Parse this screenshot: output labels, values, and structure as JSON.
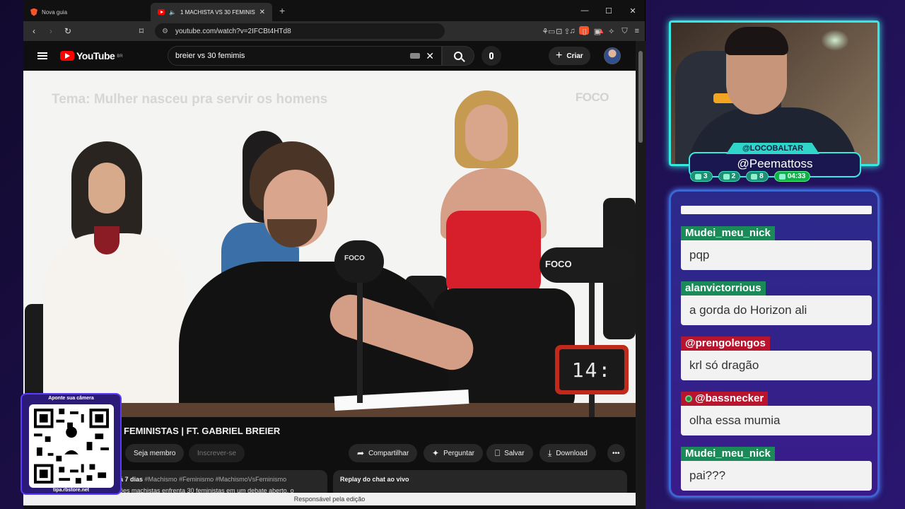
{
  "browser": {
    "tabs": [
      {
        "title": "Nova guia",
        "active": false
      },
      {
        "title": "1 MACHISTA VS 30 FEMINISTAS | FT.",
        "active": true
      }
    ],
    "url": "youtube.com/watch?v=2IFCBt4HTd8",
    "shield_count": "99+",
    "alert_count": "1"
  },
  "youtube": {
    "logo_text": "YouTube",
    "country": "BR",
    "search_value": "breier vs 30 femimis",
    "create_label": "Criar",
    "video": {
      "theme_caption": "Tema: Mulher nasceu pra servir os homens",
      "channel_watermark": "FOCO",
      "mic_logo_left": "FOCO",
      "mic_logo_right": "FOCO",
      "timer_display": "14:",
      "title": "FEMINISTAS | FT. GABRIEL BREIER"
    },
    "actions": {
      "join": "Seja membro",
      "subscribe": "Inscrever-se",
      "share": "Compartilhar",
      "ask": "Perguntar",
      "save": "Salvar",
      "download": "Download",
      "more": "•••"
    },
    "description": {
      "meta": "á 7 dias",
      "tags": "#Machismo #Feminismo #MachismoVsFeminismo",
      "line2": "ões machistas enfrenta 30 feministas em um debate aberto, o"
    },
    "chat_replay": "Replay do chat ao vivo",
    "edit_notice": "Responsável pela edição"
  },
  "qr": {
    "top_label": "Aponte sua câmera",
    "bottom_label": "tipa.rbstore.net"
  },
  "stream": {
    "handle": "@LOCOBALTAR",
    "name": "@Peemattoss",
    "stats": [
      {
        "icon": "chat-icon",
        "value": "3"
      },
      {
        "icon": "video-icon",
        "value": "2"
      },
      {
        "icon": "viewers-icon",
        "value": "8"
      },
      {
        "icon": "clock-icon",
        "value": "04:33"
      }
    ]
  },
  "chat": {
    "messages": [
      {
        "user": "Mudei_meu_nick",
        "text": "pqp",
        "color": "#1a8a58"
      },
      {
        "user": "alanvictorrious",
        "text": "a gorda do Horizon ali",
        "color": "#1a8a58"
      },
      {
        "user": "@prengolengos",
        "text": "krl só dragão",
        "color": "#b8142e"
      },
      {
        "user": "@bassnecker",
        "text": "olha essa mumia",
        "color": "#b8142e"
      },
      {
        "user": "Mudei_meu_nick",
        "text": "pai???",
        "color": "#1a8a58"
      }
    ]
  }
}
